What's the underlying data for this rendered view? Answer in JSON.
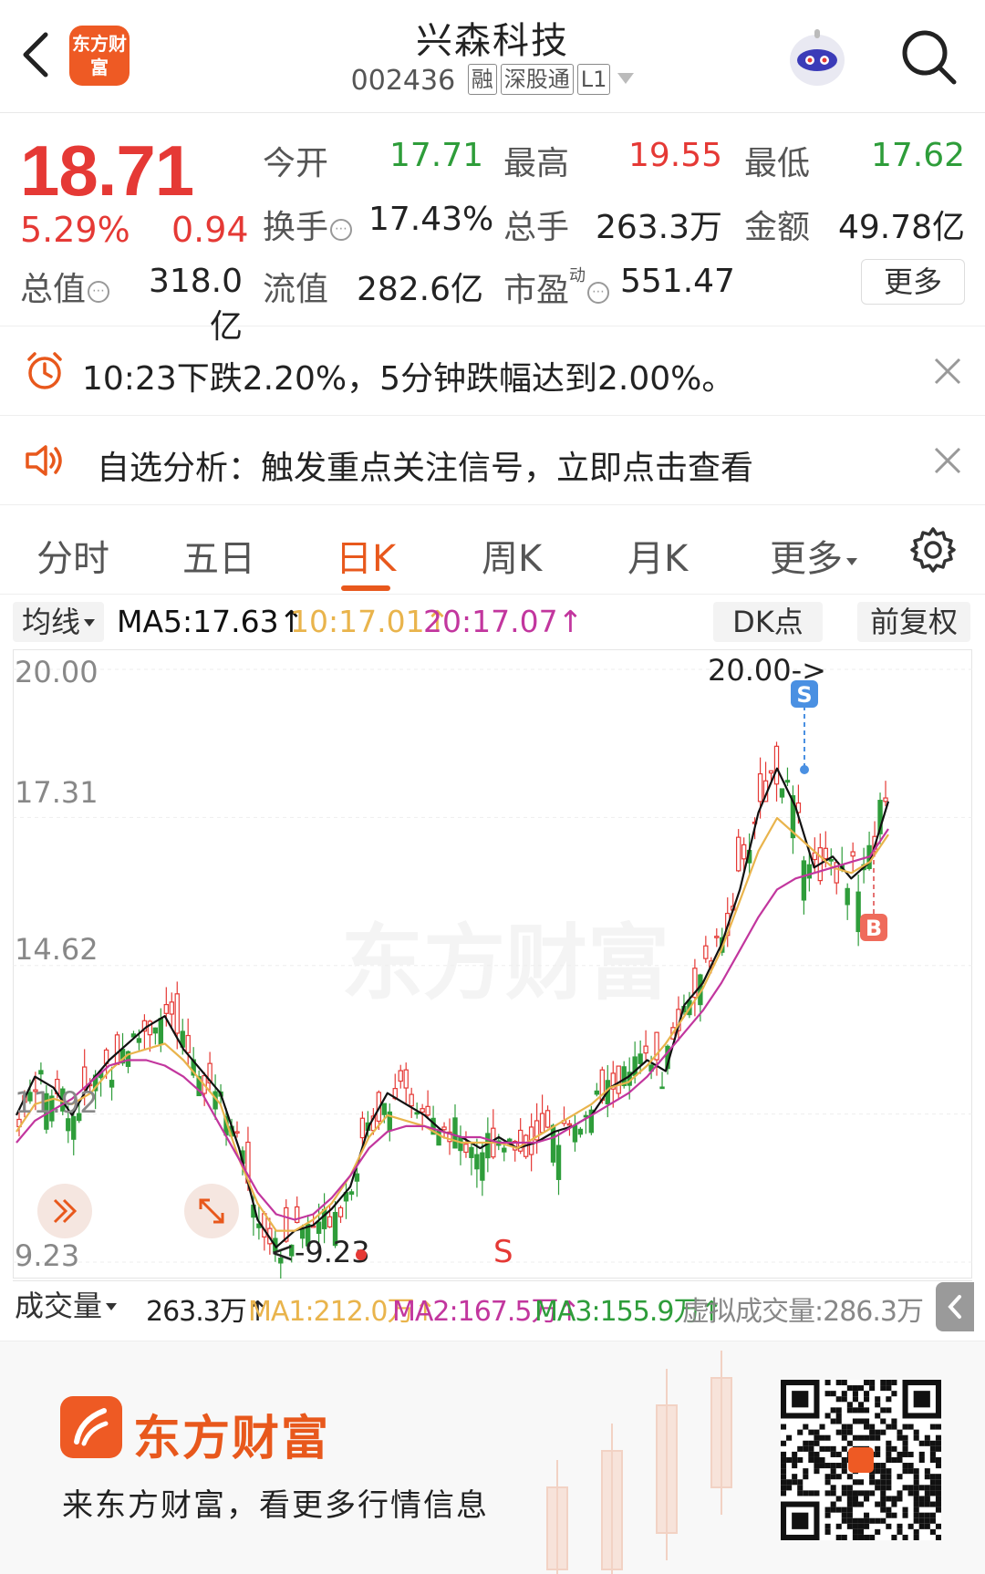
{
  "header": {
    "app_logo_text": "东方财富",
    "stock_name": "兴森科技",
    "stock_code": "002436",
    "tags": [
      "融",
      "深股通",
      "L1"
    ]
  },
  "quote": {
    "price": "18.71",
    "change_pct": "5.29%",
    "change_abs": "0.94",
    "open_label": "今开",
    "open": "17.71",
    "high_label": "最高",
    "high": "19.55",
    "low_label": "最低",
    "low": "17.62",
    "turnover_label": "换手",
    "turnover": "17.43%",
    "volume_label": "总手",
    "volume": "263.3万",
    "amount_label": "金额",
    "amount": "49.78亿",
    "mktcap_label": "总值",
    "mktcap": "318.0亿",
    "float_label": "流值",
    "float_cap": "282.6亿",
    "pe_label": "市盈",
    "pe_sup": "动",
    "pe": "551.47",
    "more": "更多"
  },
  "alerts": [
    {
      "text": "10:23下跌2.20%，5分钟跌幅达到2.00%。",
      "icon": "alarm-clock-icon"
    },
    {
      "text": "自选分析：触发重点关注信号，立即点击查看",
      "icon": "speaker-icon"
    }
  ],
  "tabs": [
    "分时",
    "五日",
    "日K",
    "周K",
    "月K",
    "更多"
  ],
  "active_tab": "日K",
  "ma_bar": {
    "select": "均线",
    "ma5": "MA5:17.63↑",
    "ma10": "10:17.01↑",
    "ma20": "20:17.07↑",
    "dk": "DK点",
    "adjust": "前复权"
  },
  "colors": {
    "up": "#e53935",
    "down": "#2e9d3a",
    "ma5": "#111111",
    "ma10": "#e9b44c",
    "ma20": "#c2369e",
    "accent": "#e8581c"
  },
  "chart_data": {
    "type": "candlestick",
    "y_ticks": [
      "20.00",
      "17.31",
      "14.62",
      "11.92",
      "9.23"
    ],
    "max_label": "20.00->",
    "min_label": "<-9.23",
    "markers": [
      "S",
      "B",
      "S"
    ],
    "watermark": "东方财富",
    "ylim": [
      9.23,
      20.0
    ],
    "series": [
      {
        "name": "MA5",
        "values": [
          11.9,
          12.6,
          12.4,
          11.9,
          12.5,
          12.9,
          13.2,
          13.5,
          13.7,
          13.1,
          12.7,
          12.3,
          11.3,
          10.0,
          9.5,
          9.8,
          9.9,
          10.2,
          10.6,
          11.7,
          12.3,
          12.1,
          11.9,
          11.6,
          11.5,
          11.3,
          11.5,
          11.3,
          11.4,
          11.6,
          11.7,
          11.9,
          12.4,
          12.6,
          12.9,
          12.7,
          13.9,
          14.3,
          15.0,
          16.0,
          17.4,
          18.2,
          17.5,
          16.4,
          16.6,
          16.2,
          16.5,
          17.6
        ]
      },
      {
        "name": "MA10",
        "values": [
          11.6,
          12.1,
          12.2,
          12.1,
          12.3,
          12.7,
          13.0,
          13.1,
          13.2,
          12.9,
          12.5,
          12.1,
          11.1,
          10.3,
          9.8,
          9.8,
          10.0,
          10.3,
          10.8,
          11.5,
          11.9,
          11.8,
          11.7,
          11.5,
          11.4,
          11.4,
          11.4,
          11.3,
          11.5,
          11.7,
          11.9,
          12.1,
          12.4,
          12.5,
          12.8,
          13.2,
          13.7,
          14.2,
          14.9,
          15.8,
          16.7,
          17.3,
          17.0,
          16.7,
          16.4,
          16.3,
          16.5,
          17.0
        ]
      },
      {
        "name": "MA20",
        "values": [
          11.4,
          11.8,
          12.0,
          12.2,
          12.5,
          12.8,
          12.9,
          12.9,
          12.8,
          12.6,
          12.3,
          11.7,
          11.1,
          10.5,
          10.1,
          10.0,
          10.1,
          10.4,
          10.8,
          11.3,
          11.6,
          11.7,
          11.7,
          11.6,
          11.5,
          11.5,
          11.4,
          11.4,
          11.4,
          11.5,
          11.7,
          11.9,
          12.1,
          12.3,
          12.6,
          13.0,
          13.4,
          13.8,
          14.3,
          14.9,
          15.5,
          16.0,
          16.2,
          16.3,
          16.4,
          16.5,
          16.6,
          17.1
        ]
      }
    ]
  },
  "volume_bar": {
    "select": "成交量",
    "vol": "263.3万↑",
    "ma1": "MA1:212.0万↑",
    "ma2": "MA2:167.5万↑",
    "ma3": "MA3:155.9万↑",
    "virtual": "虚拟成交量:286.3万"
  },
  "banner": {
    "brand": "东方财富",
    "slogan": "来东方财富，看更多行情信息"
  }
}
